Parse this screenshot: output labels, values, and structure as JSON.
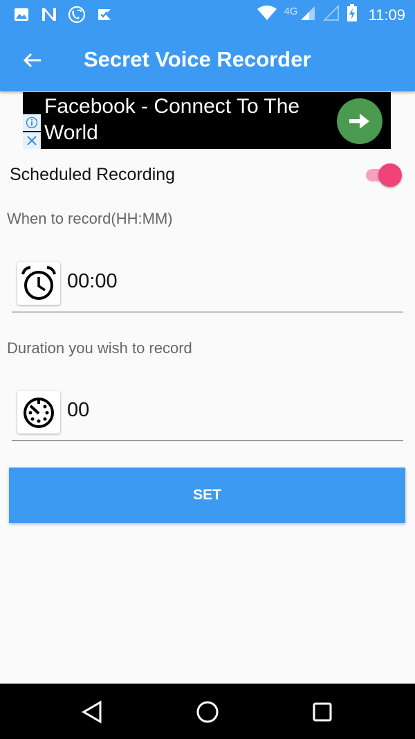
{
  "status_bar": {
    "time": "11:09",
    "network_label": "4G",
    "icons": [
      "image-icon",
      "n-icon",
      "phone-sync-icon",
      "inbox-check-icon",
      "wifi-icon",
      "signal-icon",
      "signal-icon-2",
      "battery-charging-icon"
    ]
  },
  "app_bar": {
    "title": "Secret Voice Recorder",
    "back_icon": "arrow-left-icon"
  },
  "ad": {
    "text": "Facebook - Connect To The World",
    "go_icon": "arrow-right-icon",
    "info_icon": "info-icon",
    "close_icon": "close-icon"
  },
  "scheduled": {
    "label": "Scheduled Recording",
    "enabled": true,
    "accent": "#f0437a"
  },
  "when": {
    "label": "When to record(HH:MM)",
    "value": "00:00",
    "icon": "alarm-clock-icon"
  },
  "duration": {
    "label": "Duration you wish to record",
    "value": "00",
    "icon": "timer-icon"
  },
  "set_button": {
    "label": "SET"
  },
  "colors": {
    "primary": "#3d9af3",
    "background": "#fafafa"
  },
  "nav": {
    "icons": [
      "back-triangle-icon",
      "home-circle-icon",
      "recents-square-icon"
    ]
  }
}
